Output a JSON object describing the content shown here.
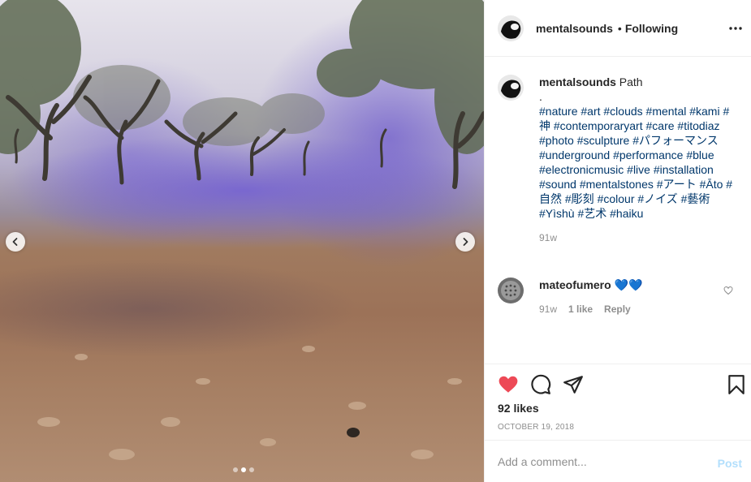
{
  "post": {
    "author": "mentalsounds",
    "separator": "•",
    "follow_status": "Following",
    "more_icon": "more-horizontal-icon"
  },
  "caption": {
    "username": "mentalsounds",
    "title": "Path",
    "dot_line": ".",
    "hashtags": "#nature #art #clouds #mental #kami #神 #contemporaryart #care #titodiaz #photo #sculpture #パフォーマンス #underground #performance #blue #electronicmusic #live #installation #sound #mentalstones #アート #Āto #自然 #彫刻 #colour #ノイズ #藝術 #Yìshù #艺术 #haiku",
    "time": "91w"
  },
  "comment": {
    "username": "mateofumero",
    "text": "💙💙",
    "time": "91w",
    "likes": "1 like",
    "reply_label": "Reply",
    "like_icon": "heart-outline-icon"
  },
  "actions": {
    "like_icon": "heart-filled-icon",
    "comment_icon": "comment-icon",
    "share_icon": "share-icon",
    "save_icon": "bookmark-icon",
    "like_color": "#ed4956"
  },
  "likes_count": "92 likes",
  "date": "OCTOBER 19, 2018",
  "comment_input": {
    "placeholder": "Add a comment...",
    "post_label": "Post",
    "post_color": "#b2dffc"
  },
  "carousel": {
    "prev_icon": "chevron-left-icon",
    "next_icon": "chevron-right-icon",
    "total": 3,
    "active_index": 2
  }
}
